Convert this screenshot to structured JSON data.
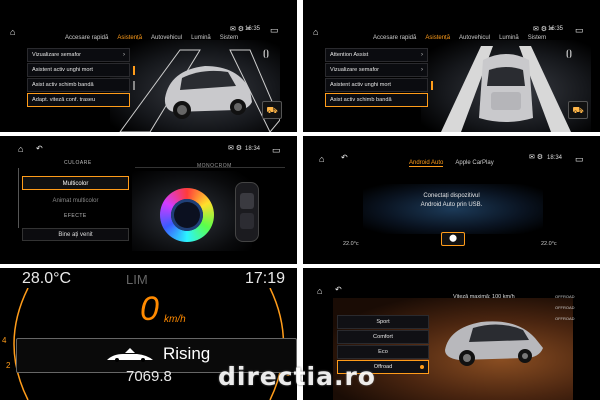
{
  "panel1": {
    "time": "16:35",
    "tabs": [
      "Accesare rapidă",
      "Asistență",
      "Autovehicul",
      "Lumină",
      "Sistem"
    ],
    "active_tab": "Asistență",
    "menu": [
      {
        "label": "Vizualizare semafor",
        "chev": "›"
      },
      {
        "label": "Asistent activ unghi mort",
        "chev": ""
      },
      {
        "label": "Asist activ schimb bandă",
        "chev": ""
      },
      {
        "label": "Adapt. viteză conf. traseu",
        "chev": ""
      }
    ]
  },
  "panel2": {
    "time": "16:35",
    "tabs": [
      "Accesare rapidă",
      "Asistență",
      "Autovehicul",
      "Lumină",
      "Sistem"
    ],
    "active_tab": "Asistență",
    "menu": [
      {
        "label": "Attention Assist",
        "chev": "›"
      },
      {
        "label": "Vizualizare semafor",
        "chev": "›"
      },
      {
        "label": "Asistent activ unghi mort",
        "chev": ""
      },
      {
        "label": "Asist activ schimb bandă",
        "chev": ""
      }
    ]
  },
  "panel3": {
    "time": "18:34",
    "section_color": "CULOARE",
    "section_mono": "MONOCROM",
    "section_effects": "EFECTE",
    "items": [
      "Multicolor",
      "Animat multicolor",
      "Bine ați venit"
    ]
  },
  "panel4": {
    "time": "18:34",
    "tabs": [
      "Android Auto",
      "Apple CarPlay"
    ],
    "active_tab": "Android Auto",
    "message_line1": "Conectați dispozitivul",
    "message_line2": "Android Auto prin USB.",
    "temp_left": "22.0°c",
    "temp_right": "22.0°c"
  },
  "panel5": {
    "outside_temp": "28.0°C",
    "limit": "LIM",
    "clock": "17:19",
    "speed": "0",
    "speed_unit": "km/h",
    "status": "Rising",
    "odometer": "7069.8"
  },
  "panel6": {
    "top_label": "Viteză maximă: 100 km/h",
    "modes": [
      "Sport",
      "Comfort",
      "Eco",
      "Offroad"
    ],
    "active_mode": "Offroad",
    "side_labels": [
      "OFFROAD",
      "OFFROAD",
      "OFFROAD"
    ]
  },
  "watermark": "directia.ro",
  "colors": {
    "accent": "#ff9c1a",
    "speed_orange": "#ff8a00"
  }
}
